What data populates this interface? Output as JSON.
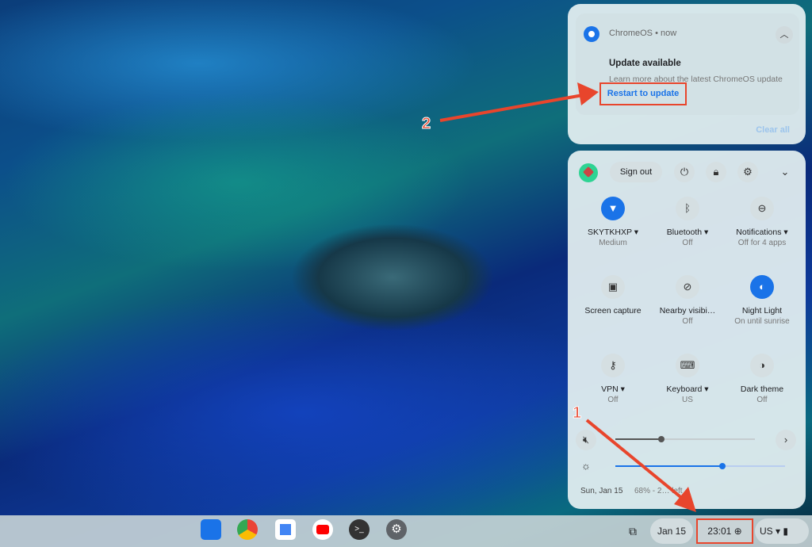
{
  "notification": {
    "source": "ChromeOS • now",
    "title": "Update available",
    "body": "Learn more about the latest ChromeOS update",
    "action": "Restart to update",
    "clear_all": "Clear all"
  },
  "quick_settings": {
    "sign_out": "Sign out",
    "tiles": [
      {
        "label": "SKYTKHXP ▾",
        "sub": "Medium",
        "icon": "wifi-icon",
        "on": true
      },
      {
        "label": "Bluetooth ▾",
        "sub": "Off",
        "icon": "bluetooth-icon",
        "on": false
      },
      {
        "label": "Notifications ▾",
        "sub": "Off for 4 apps",
        "icon": "do-not-disturb-icon",
        "on": false
      },
      {
        "label": "Screen capture",
        "sub": "",
        "icon": "screen-capture-icon",
        "on": false
      },
      {
        "label": "Nearby visibi…",
        "sub": "Off",
        "icon": "nearby-icon",
        "on": false
      },
      {
        "label": "Night Light",
        "sub": "On until sunrise",
        "icon": "night-light-icon",
        "on": true
      },
      {
        "label": "VPN ▾",
        "sub": "Off",
        "icon": "vpn-key-icon",
        "on": false
      },
      {
        "label": "Keyboard ▾",
        "sub": "US",
        "icon": "keyboard-icon",
        "on": false
      },
      {
        "label": "Dark theme",
        "sub": "Off",
        "icon": "dark-theme-icon",
        "on": false
      }
    ],
    "volume_level": 0.33,
    "brightness_level": 0.63,
    "date": "Sun, Jan 15",
    "battery": "68% - 2… left"
  },
  "shelf": {
    "date": "Jan 15",
    "time": "23:01",
    "ime": "US"
  },
  "annotations": {
    "step1": "1",
    "step2": "2"
  },
  "colors": {
    "accent": "#1a73e8",
    "annotation": "#e8452c"
  }
}
